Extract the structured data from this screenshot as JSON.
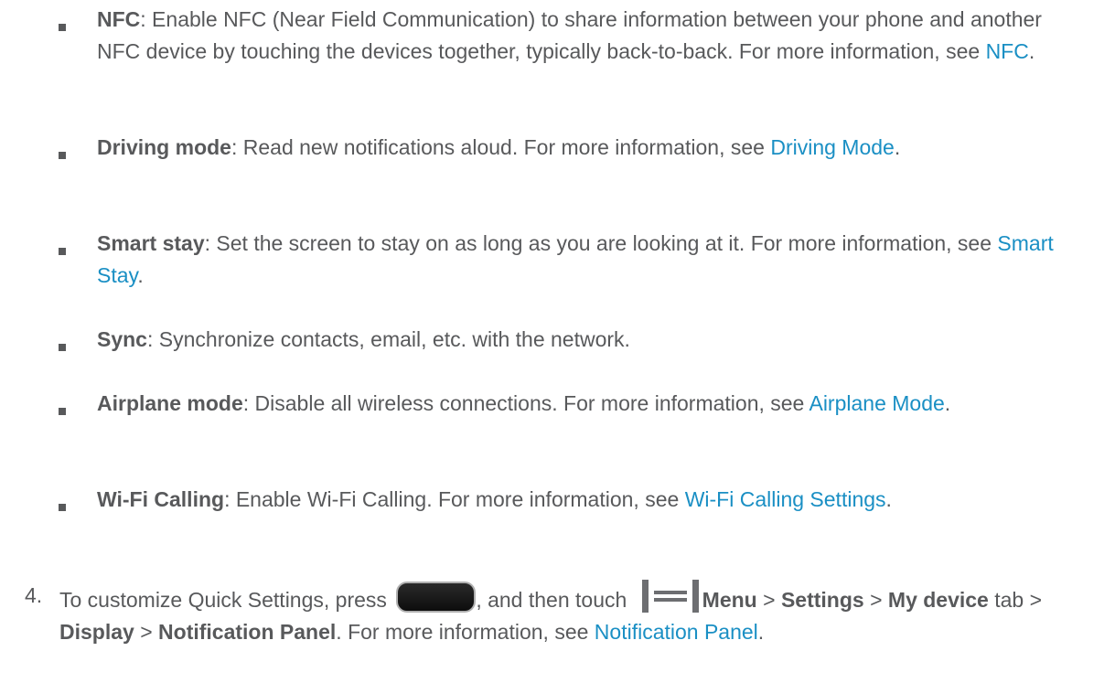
{
  "bullets": [
    {
      "term": "NFC",
      "text": ": Enable NFC (Near Field Communication) to share information between your phone and another NFC device by touching the devices together, typically back-to-back. For more information, see ",
      "link": "NFC",
      "end": "."
    },
    {
      "term": "Driving mode",
      "text": ": Read new notifications aloud. For more information, see ",
      "link": "Driving Mode",
      "end": "."
    },
    {
      "term": "Smart stay",
      "text": ": Set the screen to stay on as long as you are looking at it. For more information, see ",
      "link": "Smart Stay",
      "end": "."
    },
    {
      "term": "Sync",
      "text": ": Synchronize contacts, email, etc. with the network.",
      "link": "",
      "end": ""
    },
    {
      "term": "Airplane mode",
      "text": ": Disable all wireless connections. For more information, see ",
      "link": "Airplane Mode",
      "end": "."
    },
    {
      "term": "Wi-Fi Calling",
      "text": ": Enable Wi-Fi Calling. For more information, see ",
      "link": "Wi-Fi Calling Settings",
      "end": "."
    }
  ],
  "step": {
    "number": "4.",
    "part1": "To customize Quick Settings, press ",
    "part2": ", and then touch ",
    "menu": "Menu",
    "sep1": " > ",
    "settings": "Settings",
    "sep2": " > ",
    "my_device": "My device",
    "tab_text": " tab > ",
    "display": "Display",
    "sep3": " > ",
    "notification_panel": "Notification Panel",
    "more": ". For more information, see ",
    "link": "Notification Panel",
    "end": "."
  },
  "icons": {
    "home_button": "home-button-icon",
    "menu": "menu-icon"
  },
  "colors": {
    "text": "#58595b",
    "link": "#1a8fc4"
  }
}
